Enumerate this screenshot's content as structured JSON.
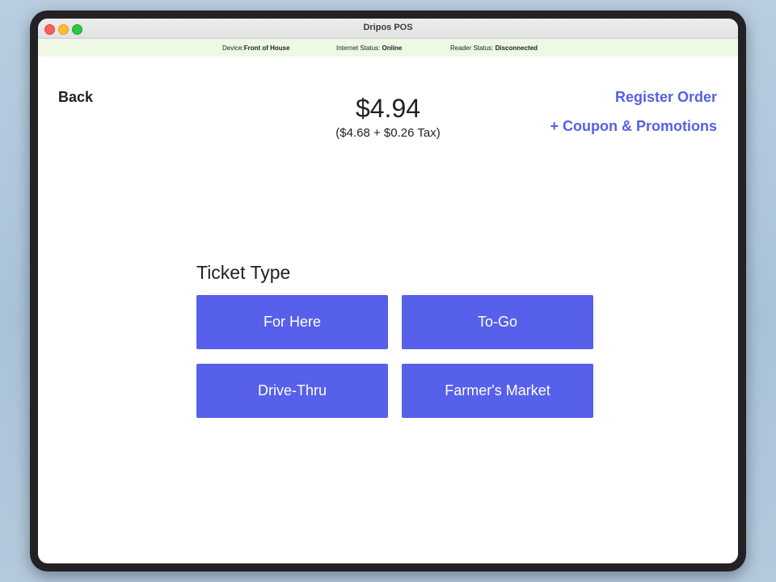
{
  "window": {
    "title": "Dripos POS"
  },
  "status": {
    "device_label": "Device:",
    "device_value": "Front of House",
    "internet_label": "Internet Status: ",
    "internet_value": "Online",
    "reader_label": "Reader Status: ",
    "reader_value": "Disconnected"
  },
  "header": {
    "back_label": "Back",
    "total": "$4.94",
    "subtotal": "($4.68 + $0.26 Tax)",
    "register_label": "Register Order",
    "coupon_label": "+ Coupon & Promotions"
  },
  "ticket": {
    "heading": "Ticket Type",
    "options": [
      "For Here",
      "To-Go",
      "Drive-Thru",
      "Farmer's Market"
    ]
  },
  "colors": {
    "accent": "#5660ea",
    "link": "#5560e8",
    "status_bar_bg": "#eef8e4"
  }
}
